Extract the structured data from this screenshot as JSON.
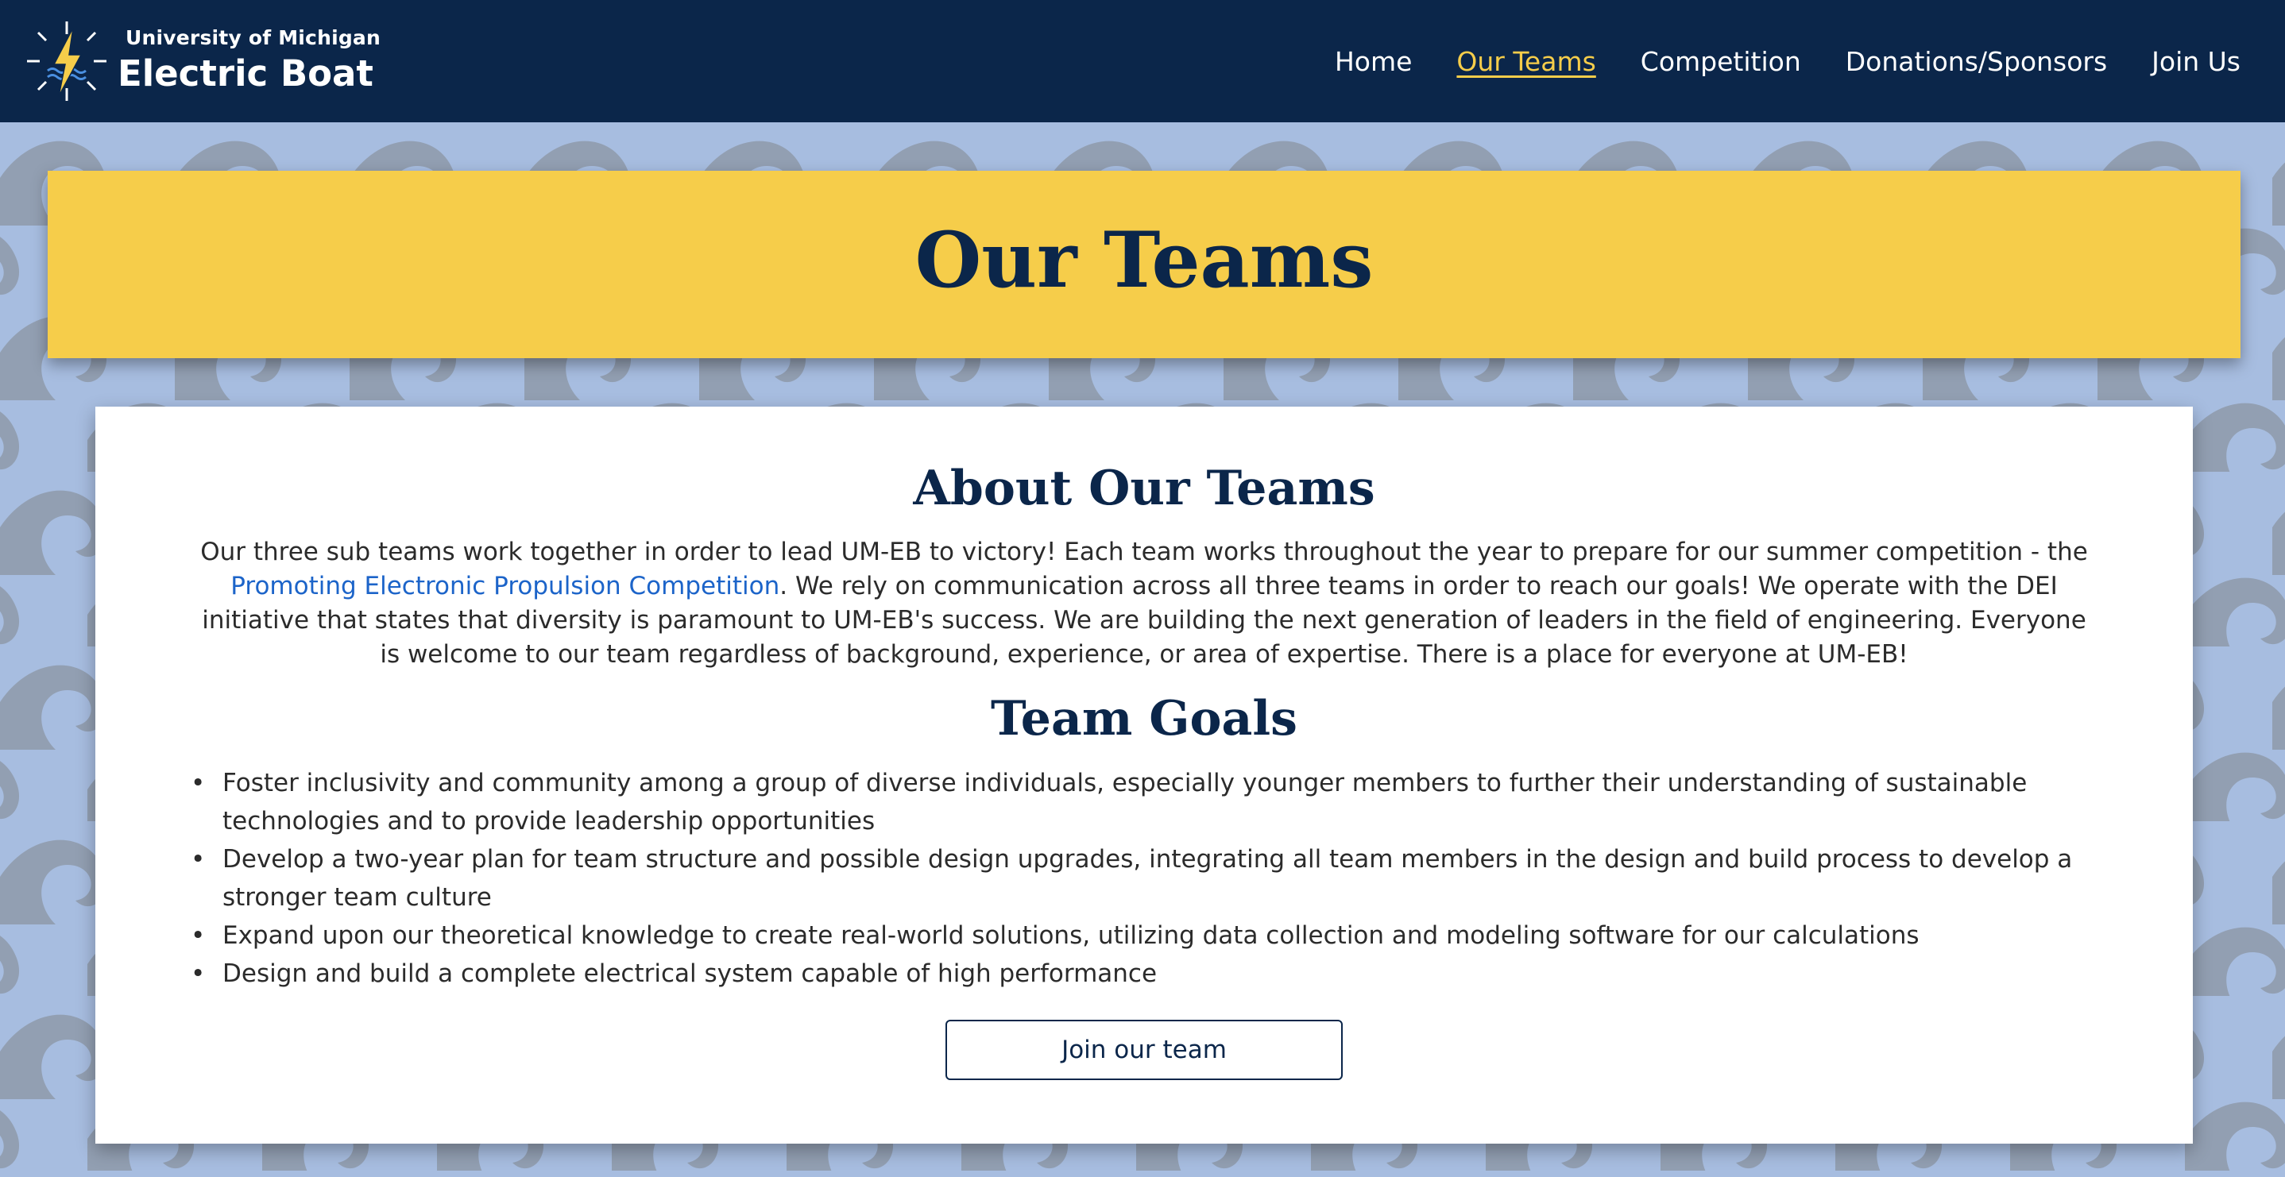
{
  "brand": {
    "small": "University of Michigan",
    "big": "Electric Boat",
    "logo_icon": "lightning-compass-logo-icon"
  },
  "nav": {
    "items": [
      {
        "label": "Home",
        "active": false
      },
      {
        "label": "Our Teams",
        "active": true
      },
      {
        "label": "Competition",
        "active": false
      },
      {
        "label": "Donations/Sponsors",
        "active": false
      },
      {
        "label": "Join Us",
        "active": false
      }
    ]
  },
  "hero": {
    "title": "Our Teams"
  },
  "about": {
    "heading": "About Our Teams",
    "text_before": "Our three sub teams work together in order to lead UM-EB to victory! Each team works throughout the year to prepare for our summer competition - the ",
    "link_text": "Promoting Electronic Propulsion Competition",
    "text_after": ". We rely on communication across all three teams in order to reach our goals! We operate with the DEI initiative that states that diversity is paramount to UM-EB's success. We are building the next generation of leaders in the field of engineering. Everyone is welcome to our team regardless of background, experience, or area of expertise. There is a place for everyone at UM-EB!"
  },
  "goals": {
    "heading": "Team Goals",
    "bullet": "•",
    "items": [
      "Foster inclusivity and community among a group of diverse individuals, especially younger members to further their understanding of sustainable technologies and to provide leadership opportunities",
      "Develop a two-year plan for team structure and possible design upgrades, integrating all team members in the design and build process to develop a stronger team culture",
      "Expand upon our theoretical knowledge to create real-world solutions, utilizing data collection and modeling software for our calculations",
      "Design and build a complete electrical system capable of high performance"
    ]
  },
  "cta": {
    "label": "Join our team"
  },
  "colors": {
    "navy": "#0b264a",
    "maize": "#f6cd4a",
    "wave_light": "#a7bde0",
    "wave_dark": "#929fb2",
    "link": "#1c64c9"
  }
}
